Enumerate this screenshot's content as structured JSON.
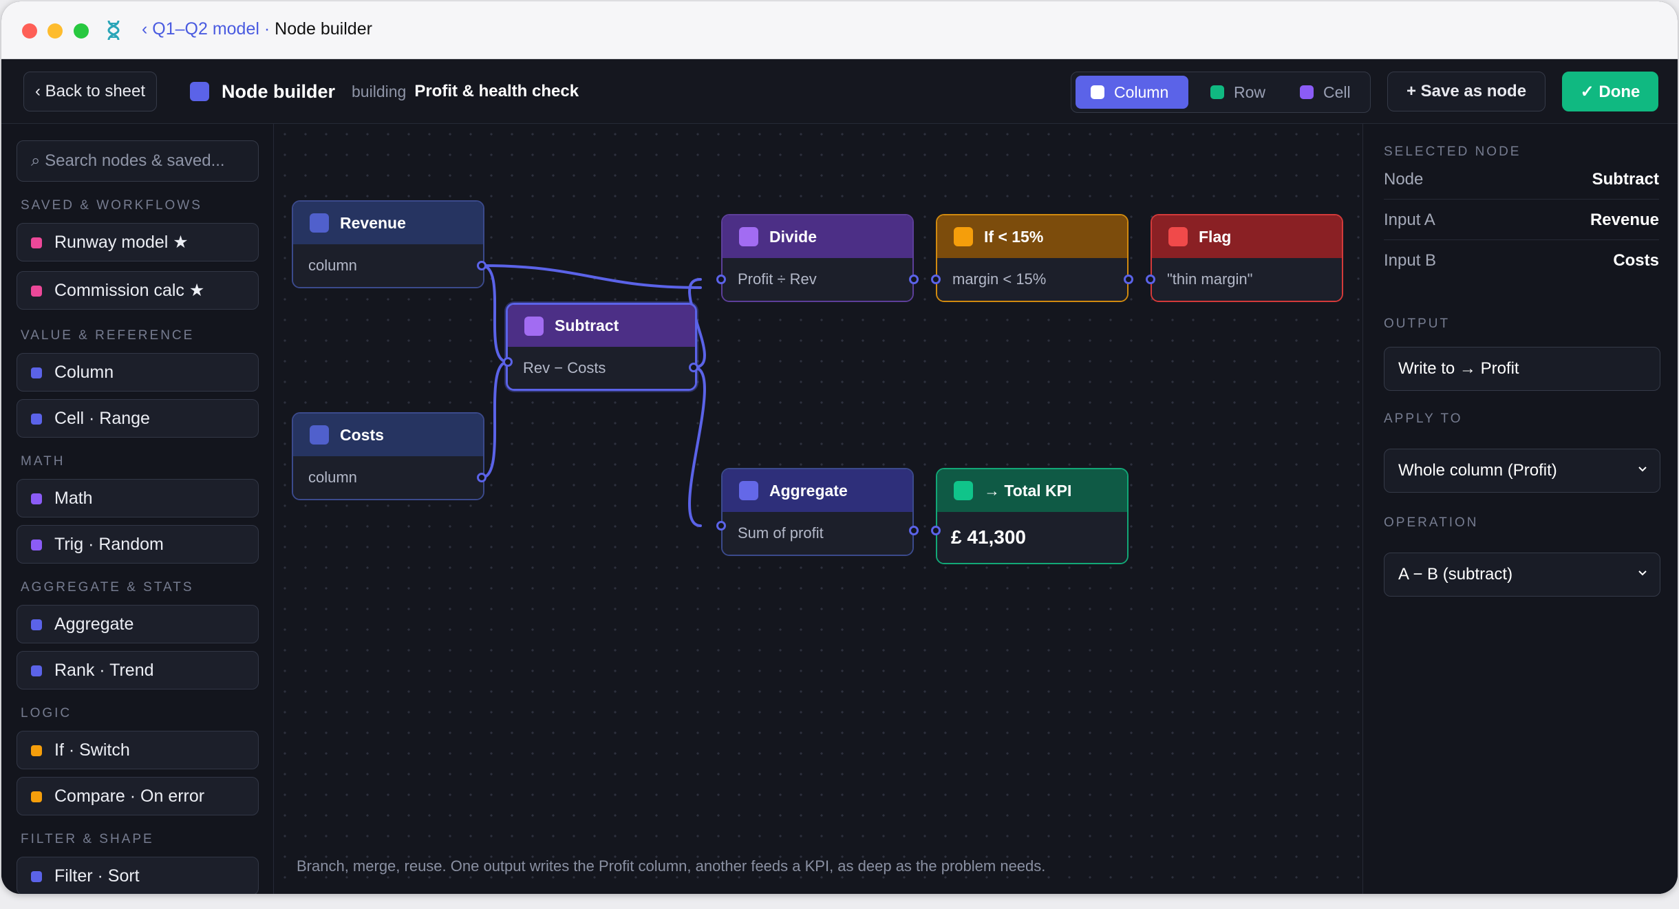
{
  "titlebar": {
    "crumb_link": "‹ Q1–Q2 model",
    "crumb_sep": "·",
    "crumb_current": "Node builder"
  },
  "toolbar": {
    "back_label": "‹ Back to sheet",
    "title": "Node builder",
    "building_prefix": "building",
    "building_name": "Profit & health check",
    "modes": [
      {
        "label": "Column",
        "active": true,
        "color": "#ffffff"
      },
      {
        "label": "Row",
        "active": false,
        "color": "#10b981"
      },
      {
        "label": "Cell",
        "active": false,
        "color": "#8b5cf6"
      }
    ],
    "save_label": "+ Save as node",
    "done_label": "✓ Done"
  },
  "sidebar": {
    "search_placeholder": "⌕ Search nodes & saved...",
    "sections": [
      {
        "title": "SAVED & WORKFLOWS",
        "items": [
          {
            "label": "Runway model ★",
            "color": "#ec4899"
          },
          {
            "label": "Commission calc ★",
            "color": "#ec4899"
          }
        ]
      },
      {
        "title": "VALUE & REFERENCE",
        "items": [
          {
            "label": "Column",
            "color": "#5b63e8"
          },
          {
            "label": "Cell · Range",
            "color": "#5b63e8"
          }
        ]
      },
      {
        "title": "MATH",
        "items": [
          {
            "label": "Math",
            "color": "#8b5cf6"
          },
          {
            "label": "Trig · Random",
            "color": "#8b5cf6"
          }
        ]
      },
      {
        "title": "AGGREGATE & STATS",
        "items": [
          {
            "label": "Aggregate",
            "color": "#5b63e8"
          },
          {
            "label": "Rank · Trend",
            "color": "#5b63e8"
          }
        ]
      },
      {
        "title": "LOGIC",
        "items": [
          {
            "label": "If · Switch",
            "color": "#f59e0b"
          },
          {
            "label": "Compare · On error",
            "color": "#f59e0b"
          }
        ]
      },
      {
        "title": "FILTER & SHAPE",
        "items": [
          {
            "label": "Filter · Sort",
            "color": "#5b63e8"
          }
        ]
      }
    ]
  },
  "canvas": {
    "nodes": {
      "revenue": {
        "title": "Revenue",
        "body": "column"
      },
      "costs": {
        "title": "Costs",
        "body": "column"
      },
      "subtract": {
        "title": "Subtract",
        "body": "Rev − Costs"
      },
      "divide": {
        "title": "Divide",
        "body": "Profit ÷ Rev"
      },
      "if": {
        "title": "If < 15%",
        "body": "margin < 15%"
      },
      "flag": {
        "title": "Flag",
        "body": "\"thin margin\""
      },
      "aggregate": {
        "title": "Aggregate",
        "body": "Sum of profit"
      },
      "kpi": {
        "title": "→ Total KPI",
        "body": "£ 41,300"
      }
    },
    "caption": "Branch, merge, reuse. One output writes the Profit column, another feeds a KPI, as deep as the problem needs."
  },
  "panel": {
    "selected_title": "SELECTED NODE",
    "rows": [
      {
        "key": "Node",
        "value": "Subtract"
      },
      {
        "key": "Input A",
        "value": "Revenue"
      },
      {
        "key": "Input B",
        "value": "Costs"
      }
    ],
    "output_title": "OUTPUT",
    "output_value": "Write to → Profit",
    "apply_title": "APPLY TO",
    "apply_value": "Whole column (Profit)",
    "operation_title": "OPERATION",
    "operation_value": "A − B (subtract)"
  }
}
